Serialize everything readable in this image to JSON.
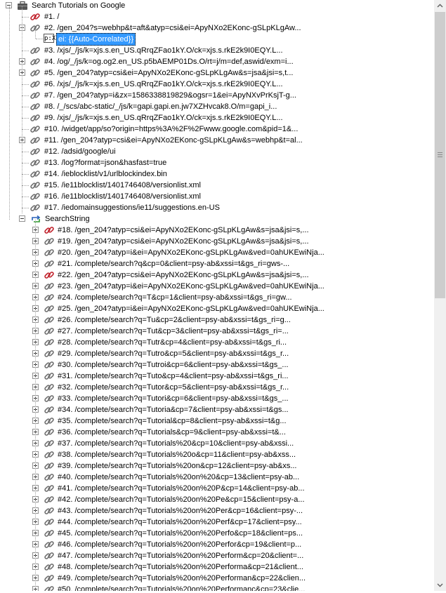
{
  "root": {
    "label": "Search Tutorials on Google",
    "expanded": true
  },
  "groupSearchString": {
    "label": "SearchString",
    "expanded": true
  },
  "selectedChild": {
    "prefix": "p:X",
    "label": "ei: {{Auto-Correlated}}"
  },
  "items": [
    {
      "label": "#1. /",
      "expander": "none",
      "icon": "link-red",
      "group": "root"
    },
    {
      "label": "#2. /gen_204?s=webhp&t=aft&atyp=csi&ei=ApyNXo2EKonc-gSLpKLgAw...",
      "expander": "minus",
      "icon": "link",
      "group": "root"
    },
    {
      "label": "#3. /xjs/_/js/k=xjs.s.en_US.qRrqZFao1kY.O/ck=xjs.s.rkE2k9I0EQY.L...",
      "expander": "none",
      "icon": "link",
      "group": "root"
    },
    {
      "label": "#4. /og/_/js/k=og.og2.en_US.p5bAEMP01Ds.O/rt=j/m=def,aswid/exm=i...",
      "expander": "plus",
      "icon": "link",
      "group": "root"
    },
    {
      "label": "#5. /gen_204?atyp=csi&ei=ApyNXo2EKonc-gSLpKLgAw&s=jsa&jsi=s,t...",
      "expander": "plus",
      "icon": "link",
      "group": "root"
    },
    {
      "label": "#6. /xjs/_/js/k=xjs.s.en_US.qRrqZFao1kY.O/ck=xjs.s.rkE2k9I0EQY.L...",
      "expander": "none",
      "icon": "link",
      "group": "root"
    },
    {
      "label": "#7. /gen_204?atyp=i&zx=1586338819829&ogsr=1&ei=ApyNXvPrKsjT-g...",
      "expander": "none",
      "icon": "link",
      "group": "root"
    },
    {
      "label": "#8. /_/scs/abc-static/_/js/k=gapi.gapi.en.jw7XZHvcak8.O/m=gapi_i...",
      "expander": "none",
      "icon": "link",
      "group": "root"
    },
    {
      "label": "#9. /xjs/_/js/k=xjs.s.en_US.qRrqZFao1kY.O/ck=xjs.s.rkE2k9I0EQY.L...",
      "expander": "none",
      "icon": "link",
      "group": "root"
    },
    {
      "label": "#10. /widget/app/so?origin=https%3A%2F%2Fwww.google.com&pid=1&...",
      "expander": "none",
      "icon": "link",
      "group": "root"
    },
    {
      "label": "#11. /gen_204?atyp=csi&ei=ApyNXo2EKonc-gSLpKLgAw&s=webhp&t=al...",
      "expander": "plus",
      "icon": "link",
      "group": "root"
    },
    {
      "label": "#12. /adsid/google/ui",
      "expander": "none",
      "icon": "link",
      "group": "root"
    },
    {
      "label": "#13. /log?format=json&hasfast=true",
      "expander": "none",
      "icon": "link",
      "group": "root"
    },
    {
      "label": "#14. /ieblocklist/v1/urlblockindex.bin",
      "expander": "none",
      "icon": "link",
      "group": "root"
    },
    {
      "label": "#15. /ie11blocklist/1401746408/versionlist.xml",
      "expander": "none",
      "icon": "link",
      "group": "root"
    },
    {
      "label": "#16. /ie11blocklist/1401746408/versionlist.xml",
      "expander": "none",
      "icon": "link",
      "group": "root"
    },
    {
      "label": "#17. /iedomainsuggestions/ie11/suggestions.en-US",
      "expander": "none",
      "icon": "link",
      "group": "root"
    },
    {
      "label": "#18. /gen_204?atyp=csi&ei=ApyNXo2EKonc-gSLpKLgAw&s=jsa&jsi=s,...",
      "expander": "plus",
      "icon": "link-red",
      "group": "ss"
    },
    {
      "label": "#19. /gen_204?atyp=csi&ei=ApyNXo2EKonc-gSLpKLgAw&s=jsa&jsi=s,...",
      "expander": "plus",
      "icon": "link",
      "group": "ss"
    },
    {
      "label": "#20. /gen_204?atyp=i&ei=ApyNXo2EKonc-gSLpKLgAw&ved=0ahUKEwiNja...",
      "expander": "plus",
      "icon": "link",
      "group": "ss"
    },
    {
      "label": "#21. /complete/search?q&cp=0&client=psy-ab&xssi=t&gs_ri=gws-...",
      "expander": "plus",
      "icon": "link",
      "group": "ss"
    },
    {
      "label": "#22. /gen_204?atyp=csi&ei=ApyNXo2EKonc-gSLpKLgAw&s=jsa&jsi=s,...",
      "expander": "plus",
      "icon": "link-red",
      "group": "ss"
    },
    {
      "label": "#23. /gen_204?atyp=i&ei=ApyNXo2EKonc-gSLpKLgAw&ved=0ahUKEwiNja...",
      "expander": "plus",
      "icon": "link",
      "group": "ss"
    },
    {
      "label": "#24. /complete/search?q=T&cp=1&client=psy-ab&xssi=t&gs_ri=gw...",
      "expander": "plus",
      "icon": "link",
      "group": "ss"
    },
    {
      "label": "#25. /gen_204?atyp=i&ei=ApyNXo2EKonc-gSLpKLgAw&ved=0ahUKEwiNja...",
      "expander": "plus",
      "icon": "link",
      "group": "ss"
    },
    {
      "label": "#26. /complete/search?q=Tu&cp=2&client=psy-ab&xssi=t&gs_ri=g...",
      "expander": "plus",
      "icon": "link",
      "group": "ss"
    },
    {
      "label": "#27. /complete/search?q=Tut&cp=3&client=psy-ab&xssi=t&gs_ri=...",
      "expander": "plus",
      "icon": "link",
      "group": "ss"
    },
    {
      "label": "#28. /complete/search?q=Tutr&cp=4&client=psy-ab&xssi=t&gs_ri...",
      "expander": "plus",
      "icon": "link",
      "group": "ss"
    },
    {
      "label": "#29. /complete/search?q=Tutro&cp=5&client=psy-ab&xssi=t&gs_r...",
      "expander": "plus",
      "icon": "link",
      "group": "ss"
    },
    {
      "label": "#30. /complete/search?q=Tutroi&cp=6&client=psy-ab&xssi=t&gs_...",
      "expander": "plus",
      "icon": "link",
      "group": "ss"
    },
    {
      "label": "#31. /complete/search?q=Tuto&cp=4&client=psy-ab&xssi=t&gs_ri...",
      "expander": "plus",
      "icon": "link",
      "group": "ss"
    },
    {
      "label": "#32. /complete/search?q=Tutor&cp=5&client=psy-ab&xssi=t&gs_r...",
      "expander": "plus",
      "icon": "link",
      "group": "ss"
    },
    {
      "label": "#33. /complete/search?q=Tutori&cp=6&client=psy-ab&xssi=t&gs_...",
      "expander": "plus",
      "icon": "link",
      "group": "ss"
    },
    {
      "label": "#34. /complete/search?q=Tutoria&cp=7&client=psy-ab&xssi=t&gs...",
      "expander": "plus",
      "icon": "link",
      "group": "ss"
    },
    {
      "label": "#35. /complete/search?q=Tutorial&cp=8&client=psy-ab&xssi=t&g...",
      "expander": "plus",
      "icon": "link",
      "group": "ss"
    },
    {
      "label": "#36. /complete/search?q=Tutorials&cp=9&client=psy-ab&xssi=t&...",
      "expander": "plus",
      "icon": "link",
      "group": "ss"
    },
    {
      "label": "#37. /complete/search?q=Tutorials%20&cp=10&client=psy-ab&xssi...",
      "expander": "plus",
      "icon": "link",
      "group": "ss"
    },
    {
      "label": "#38. /complete/search?q=Tutorials%20o&cp=11&client=psy-ab&xss...",
      "expander": "plus",
      "icon": "link",
      "group": "ss"
    },
    {
      "label": "#39. /complete/search?q=Tutorials%20on&cp=12&client=psy-ab&xs...",
      "expander": "plus",
      "icon": "link",
      "group": "ss"
    },
    {
      "label": "#40. /complete/search?q=Tutorials%20on%20&cp=13&client=psy-ab...",
      "expander": "plus",
      "icon": "link",
      "group": "ss"
    },
    {
      "label": "#41. /complete/search?q=Tutorials%20on%20P&cp=14&client=psy-ab...",
      "expander": "plus",
      "icon": "link",
      "group": "ss"
    },
    {
      "label": "#42. /complete/search?q=Tutorials%20on%20Pe&cp=15&client=psy-a...",
      "expander": "plus",
      "icon": "link",
      "group": "ss"
    },
    {
      "label": "#43. /complete/search?q=Tutorials%20on%20Per&cp=16&client=psy-...",
      "expander": "plus",
      "icon": "link",
      "group": "ss"
    },
    {
      "label": "#44. /complete/search?q=Tutorials%20on%20Perf&cp=17&client=psy...",
      "expander": "plus",
      "icon": "link",
      "group": "ss"
    },
    {
      "label": "#45. /complete/search?q=Tutorials%20on%20Perfo&cp=18&client=ps...",
      "expander": "plus",
      "icon": "link",
      "group": "ss"
    },
    {
      "label": "#46. /complete/search?q=Tutorials%20on%20Perfor&cp=19&client=p...",
      "expander": "plus",
      "icon": "link",
      "group": "ss"
    },
    {
      "label": "#47. /complete/search?q=Tutorials%20on%20Perform&cp=20&client=...",
      "expander": "plus",
      "icon": "link",
      "group": "ss"
    },
    {
      "label": "#48. /complete/search?q=Tutorials%20on%20Performa&cp=21&client...",
      "expander": "plus",
      "icon": "link",
      "group": "ss"
    },
    {
      "label": "#49. /complete/search?q=Tutorials%20on%20Performan&cp=22&clien...",
      "expander": "plus",
      "icon": "link",
      "group": "ss"
    },
    {
      "label": "#50. /complete/search?q=Tutorials%20on%20Performanc&cp=23&clie...",
      "expander": "plus",
      "icon": "link",
      "group": "ss"
    }
  ],
  "colors": {
    "selection": "#3399ff",
    "linkRed": "#c0202a",
    "linkGray": "#6e6e6e"
  }
}
